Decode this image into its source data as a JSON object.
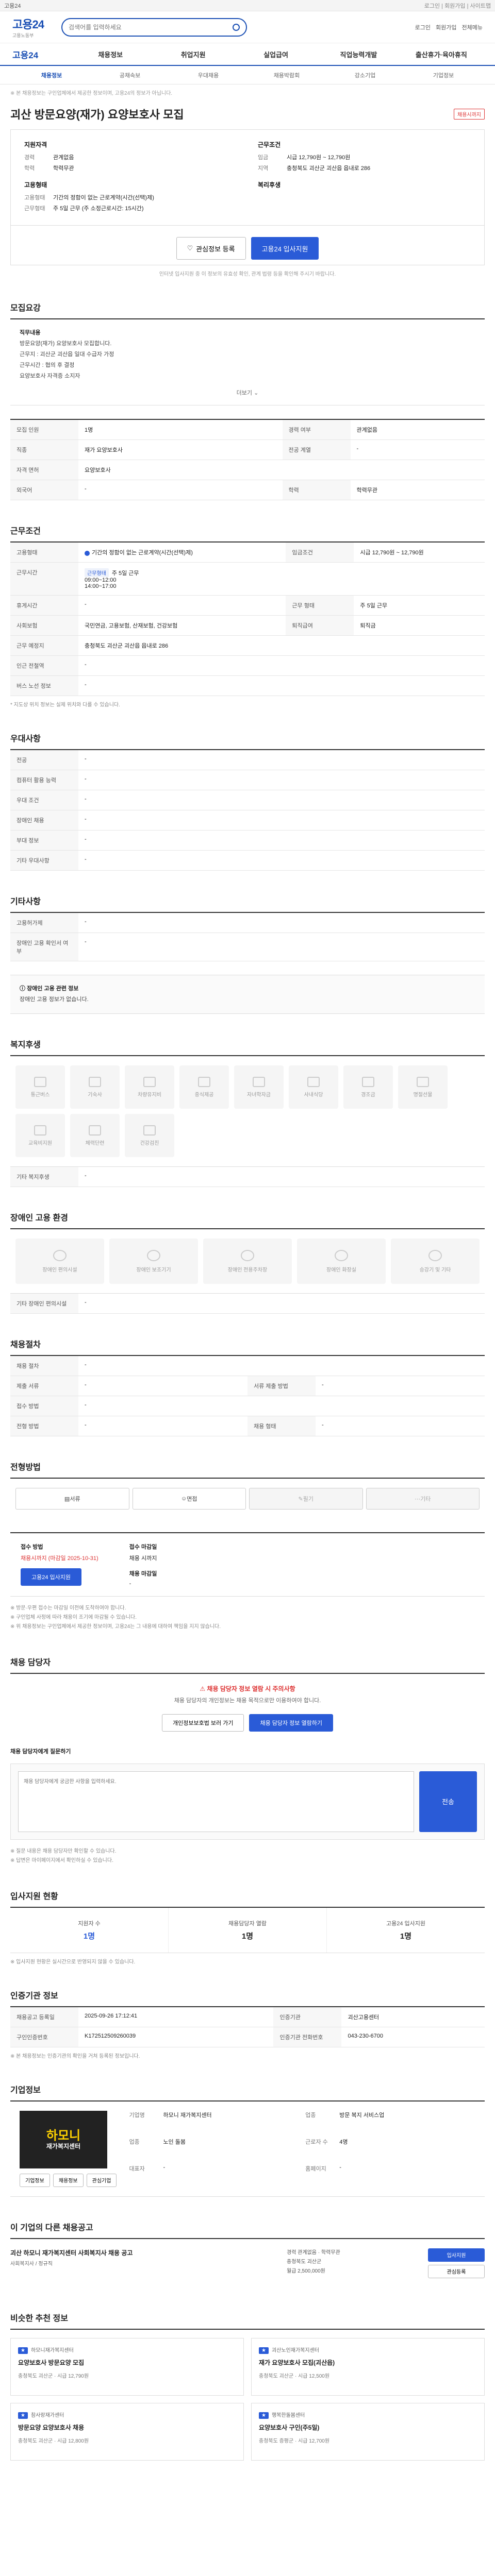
{
  "topbar": {
    "left": "고용24",
    "right": "로그인 | 회원가입 | 사이트맵"
  },
  "header": {
    "logo": "고용24",
    "logo_sub": "고용노동부",
    "search_placeholder": "검색어를 입력하세요",
    "links": [
      "로그인",
      "회원가입",
      "전체메뉴"
    ]
  },
  "gnb": {
    "brand": "고용24",
    "items": [
      "채용정보",
      "취업지원",
      "실업급여",
      "직업능력개발",
      "출산휴가·육아휴직"
    ]
  },
  "snb": {
    "items": [
      "채용정보",
      "공채속보",
      "우대채용",
      "채용박람회",
      "강소기업",
      "기업정보"
    ]
  },
  "notice": "※ 본 채용정보는 구인업체에서 제공한 정보이며, 고용24의 정보가 아닙니다.",
  "job": {
    "title": "괴산 방문요양(재가) 요양보호사 모집",
    "badge": "채용시까지",
    "summary_left_title": "지원자격",
    "summary_right_title": "근무조건",
    "summary": [
      {
        "k": "경력",
        "v": "관계없음"
      },
      {
        "k": "학력",
        "v": "학력무관"
      }
    ],
    "summary_right": [
      {
        "k": "임금",
        "v": "시급 12,790원 ~ 12,790원"
      },
      {
        "k": "지역",
        "v": "충청북도 괴산군 괴산읍 읍내로 286"
      }
    ],
    "summary2_left_title": "고용형태",
    "summary2_right_title": "복리후생",
    "summary2": [
      {
        "k": "고용형태",
        "v": "기간의 정함이 없는 근로계약(시간(선택)제)"
      },
      {
        "k": "근무형태",
        "v": "주 5일 근무 (주 소정근로시간: 15시간)"
      }
    ],
    "summary2_right": [],
    "btn_scrap": "관심정보 등록",
    "btn_apply": "고용24 입사지원",
    "tiny": "인터넷 입사지원 중 이 정보의 유효성 확인, 관계 법령 등을 확인해 주시기 바랍니다."
  },
  "duty": {
    "heading": "모집요강",
    "title": "직무내용",
    "lines": [
      "방문요양(재가) 요양보호사 모집합니다.",
      "근무지 : 괴산군 괴산읍 일대 수급자 가정",
      "근무시간 : 협의 후 결정",
      "요양보호사 자격증 소지자"
    ],
    "more": "더보기"
  },
  "req": {
    "rows": [
      {
        "k": "모집 인원",
        "v": "1명",
        "k2": "경력 여부",
        "v2": "관계없음"
      },
      {
        "k": "직종",
        "v": "재가 요양보호사",
        "k2": "전공 계열",
        "v2": "-"
      },
      {
        "k": "자격 면허",
        "v": "요양보호사",
        "k2": "",
        "v2": ""
      },
      {
        "k": "외국어",
        "v": "-",
        "k2": "학력",
        "v2": "학력무관"
      }
    ]
  },
  "cond": {
    "heading": "근무조건",
    "type_k": "고용형태",
    "type_v": "기간의 정함이 없는 근로계약(시간(선택)제)",
    "wage_k": "임금조건",
    "wage_v": "시급 12,790원 ~ 12,790원",
    "time_k": "근무시간",
    "time_tag": "근무형태",
    "time_days": "주 5일 근무",
    "time_lines": [
      "09:00~12:00",
      "14:00~17:00"
    ],
    "rows": [
      {
        "k": "휴게시간",
        "v": "-",
        "k2": "근무 형태",
        "v2": "주 5일 근무"
      },
      {
        "k": "사회보험",
        "v": "국민연금, 고용보험, 산재보험, 건강보험",
        "k2": "퇴직급여",
        "v2": "퇴직금"
      },
      {
        "k": "근무 예정지",
        "v": "충청북도 괴산군 괴산읍 읍내로 286",
        "k2": "",
        "v2": ""
      },
      {
        "k": "인근 전철역",
        "v": "-",
        "k2": "",
        "v2": ""
      },
      {
        "k": "버스 노선 정보",
        "v": "-",
        "k2": "",
        "v2": ""
      }
    ],
    "footnote": "* 지도상 위치 정보는 실제 위치와 다를 수 있습니다."
  },
  "prefer": {
    "heading": "우대사항",
    "rows": [
      {
        "k": "전공",
        "v": "-"
      },
      {
        "k": "컴퓨터 활용 능력",
        "v": "-"
      },
      {
        "k": "우대 조건",
        "v": "-"
      },
      {
        "k": "장애인 채용",
        "v": "-"
      },
      {
        "k": "부대 정보",
        "v": "-"
      },
      {
        "k": "기타 우대사항",
        "v": "-"
      }
    ]
  },
  "etc": {
    "heading": "기타사항",
    "rows": [
      {
        "k": "고용허가제",
        "v": "-"
      },
      {
        "k": "장애인 고용 확인서 여부",
        "v": "-"
      }
    ]
  },
  "disability": {
    "heading": "장애인 고용",
    "p1": "장애인 고용 관련 정보",
    "p2": "장애인 고용 정보가 없습니다."
  },
  "facility": {
    "heading": "복지후생",
    "items": [
      "통근버스",
      "기숙사",
      "차량유지비",
      "중식제공",
      "자녀학자금",
      "사내식당",
      "경조금",
      "명절선물",
      "교육비지원",
      "체력단련",
      "건강검진"
    ],
    "other_k": "기타 복지후생",
    "other_v": "-"
  },
  "disab_env": {
    "heading": "장애인 고용 환경",
    "items": [
      "장애인 편의시설",
      "장애인 보조기기",
      "장애인 전용주차장",
      "장애인 화장실",
      "승강기 및 기타"
    ],
    "other_k": "기타 장애인 편의시설",
    "other_v": "-"
  },
  "process": {
    "heading": "채용절차",
    "rows": [
      {
        "k": "채용 절차",
        "v": "-",
        "k2": "",
        "v2": ""
      },
      {
        "k": "제출 서류",
        "v": "-",
        "k2": "서류 제출 방법",
        "v2": "-"
      },
      {
        "k": "접수 방법",
        "v": "-",
        "k2": "",
        "v2": ""
      },
      {
        "k": "전형 방법",
        "v": "-",
        "k2": "채용 형태",
        "v2": "-"
      }
    ]
  },
  "method": {
    "heading": "전형방법",
    "items": [
      {
        "label": "서류",
        "off": false
      },
      {
        "label": "면접",
        "off": false
      },
      {
        "label": "필기",
        "off": true
      },
      {
        "label": "기타",
        "off": true
      }
    ]
  },
  "apply": {
    "col1_title": "접수 방법",
    "col1_red": "채용시까지 (마감일 2025-10-31)",
    "col1_btn": "고용24 입사지원",
    "col2_title": "접수 마감일",
    "col2_v": "채용 시까지",
    "col3_title": "채용 마감일",
    "col3_v": "-",
    "notes": [
      "※ 방문·우편 접수는 마감일 이전에 도착하여야 합니다.",
      "※ 구인업체 사정에 따라 채용이 조기에 마감될 수 있습니다.",
      "※ 위 채용정보는 구인업체에서 제공한 정보이며, 고용24는 그 내용에 대하여 책임을 지지 않습니다."
    ]
  },
  "manager": {
    "heading": "채용 담당자",
    "alert_title": "채용 담당자 정보 열람 시 주의사항",
    "p": "채용 담당자의 개인정보는 채용 목적으로만 이용하여야 합니다.",
    "btn1": "개인정보보호법 보러 가기",
    "btn2": "채용 담당자 정보 열람하기",
    "qna_title": "채용 담당자에게 질문하기",
    "qna_placeholder": "채용 담당자에게 궁금한 사항을 입력하세요.",
    "qna_send": "전송",
    "qna_notes": [
      "※ 질문 내용은 채용 담당자만 확인할 수 있습니다.",
      "※ 답변은 마이페이지에서 확인하실 수 있습니다."
    ]
  },
  "stats": {
    "heading": "입사지원 현황",
    "items": [
      {
        "lbl": "지원자 수",
        "num": "1명",
        "blue": true
      },
      {
        "lbl": "채용담당자 열람",
        "num": "1명",
        "blue": false
      },
      {
        "lbl": "고용24 입사지원",
        "num": "1명",
        "blue": false
      }
    ],
    "note": "※ 입사지원 현황은 실시간으로 반영되지 않을 수 있습니다."
  },
  "regist": {
    "heading": "인증기관 정보",
    "rows": [
      {
        "k": "채용공고 등록일",
        "v": "2025-09-26 17:12:41",
        "k2": "인증기관",
        "v2": "괴산고용센터"
      },
      {
        "k": "구인인증번호",
        "v": "K172512509260039",
        "k2": "인증기관 전화번호",
        "v2": "043-230-6700"
      }
    ],
    "note": "※ 본 채용정보는 인증기관의 확인을 거쳐 등록된 정보입니다."
  },
  "company": {
    "heading": "기업정보",
    "logo_main": "하모니",
    "logo_sub": "재가복지센터",
    "rows": [
      {
        "k": "기업명",
        "v": "하모니 재가복지센터",
        "k2": "업종",
        "v2": "방문 복지 서비스업"
      },
      {
        "k": "업종",
        "v": "노인 돌봄",
        "k2": "근로자 수",
        "v2": "4명"
      },
      {
        "k": "대표자",
        "v": "-",
        "k2": "홈페이지",
        "v2": "-"
      }
    ],
    "btns": [
      "기업정보",
      "채용정보",
      "관심기업"
    ]
  },
  "related": {
    "heading": "이 기업의 다른 채용공고",
    "title": "괴산 하모니 재가복지센터 사회복지사 채용 공고",
    "sub": "사회복지사 / 정규직",
    "meta": [
      "경력 관계없음 · 학력무관",
      "충청북도 괴산군",
      "월급 2,500,000원"
    ],
    "btns": [
      "입사지원",
      "관심등록"
    ]
  },
  "similar": {
    "heading": "비슷한 추천 정보",
    "cards": [
      {
        "co": "하모니재가복지센터",
        "ti": "요양보호사 방문요양 모집",
        "meta": "충청북도 괴산군 · 시급 12,790원"
      },
      {
        "co": "괴산노인재가복지센터",
        "ti": "재가 요양보호사 모집(괴산읍)",
        "meta": "충청북도 괴산군 · 시급 12,500원"
      },
      {
        "co": "참사랑재가센터",
        "ti": "방문요양 요양보호사 채용",
        "meta": "충청북도 괴산군 · 시급 12,800원"
      },
      {
        "co": "행복한돌봄센터",
        "ti": "요양보호사 구인(주5일)",
        "meta": "충청북도 증평군 · 시급 12,700원"
      }
    ]
  }
}
